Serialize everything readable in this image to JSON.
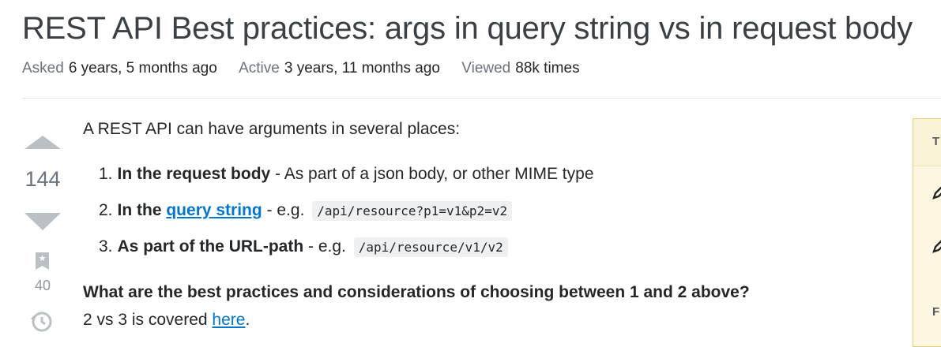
{
  "question": {
    "title": "REST API Best practices: args in query string vs in request body",
    "meta": {
      "asked_label": "Asked",
      "asked_value": "6 years, 5 months ago",
      "active_label": "Active",
      "active_value": "3 years, 11 months ago",
      "viewed_label": "Viewed",
      "viewed_value": "88k times"
    },
    "votes": {
      "score": "144",
      "bookmarks": "40"
    },
    "body": {
      "intro": "A REST API can have arguments in several places:",
      "items": [
        {
          "num": "1.",
          "bold": "In the request body",
          "text": " - As part of a json body, or other MIME type"
        },
        {
          "num": "2.",
          "bold": "In the",
          "link": "query string",
          "text": " - e.g.",
          "code": "/api/resource?p1=v1&p2=v2"
        },
        {
          "num": "3.",
          "bold": "As part of the URL-path",
          "text": " - e.g.",
          "code": "/api/resource/v1/v2"
        }
      ],
      "question_text": "What are the best practices and considerations of choosing between 1 and 2 above?",
      "last_prefix": "2 vs 3 is covered ",
      "last_link": "here",
      "last_suffix": "."
    }
  },
  "sidebar": {
    "head_text": "T",
    "foot_text": "F"
  },
  "icons": [
    "upvote-arrow-icon",
    "downvote-arrow-icon",
    "bookmark-icon",
    "history-icon",
    "pencil-icon"
  ],
  "colors": {
    "link": "#0077cc",
    "vote_arrow": "#bbc0c4",
    "sidebar_bg": "#fdf7e2"
  }
}
